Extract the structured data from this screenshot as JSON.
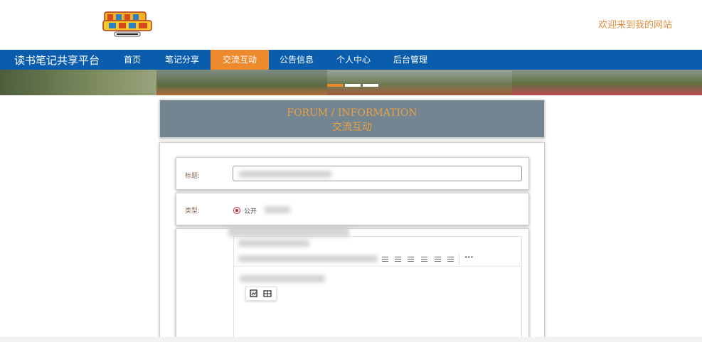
{
  "header": {
    "welcome_text": "欢迎来到我的网站",
    "logo_icon": "digimon-adventure-logo"
  },
  "navbar": {
    "brand": "读书笔记共享平台",
    "items": [
      {
        "label": "首页",
        "active": false
      },
      {
        "label": "笔记分享",
        "active": false
      },
      {
        "label": "交流互动",
        "active": true
      },
      {
        "label": "公告信息",
        "active": false
      },
      {
        "label": "个人中心",
        "active": false
      },
      {
        "label": "后台管理",
        "active": false
      }
    ]
  },
  "banner": {
    "slide_count": 3,
    "active_slide": 1
  },
  "page": {
    "title_en": "FORUM / INFORMATION",
    "title_zh": "交流互动"
  },
  "form": {
    "title_label": "标题:",
    "type_label": "类型:",
    "type_options": [
      {
        "label": "公开",
        "checked": true
      }
    ]
  },
  "editor": {
    "more_icon": "ellipsis-icon",
    "popup_icons": [
      "image-edit-icon",
      "table-icon"
    ]
  },
  "colors": {
    "nav_bg": "#0a5dac",
    "accent": "#ee8a2e",
    "title_box_bg": "#748592",
    "title_text": "#e9a043"
  }
}
